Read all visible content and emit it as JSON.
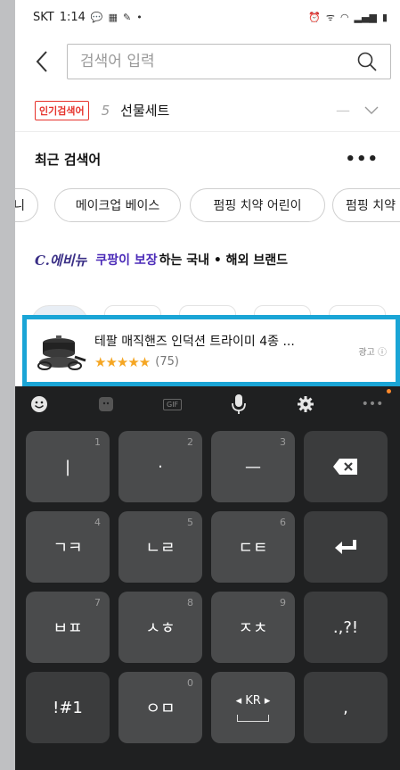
{
  "status_bar": {
    "carrier": "SKT",
    "time": "1:14"
  },
  "search": {
    "placeholder": "검색어 입력"
  },
  "popular": {
    "badge": "인기검색어",
    "rank": "5",
    "term": "선물세트"
  },
  "recent": {
    "title": "최근 검색어",
    "chips": [
      "니",
      "메이크업 베이스",
      "펌핑 치약 어린이",
      "펌핑 치약"
    ]
  },
  "brand": {
    "logo": "C.에비뉴",
    "highlight": "쿠팡이 보장",
    "rest": "하는 국내 • 해외 브랜드"
  },
  "ad": {
    "title": "테팔 매직핸즈 인덕션 트라이미 4종 ...",
    "rating_stars": 5,
    "review_count": "(75)",
    "badge": "광고"
  },
  "keyboard": {
    "rows": [
      [
        {
          "label": "|",
          "num": "1"
        },
        {
          "label": "·",
          "num": "2"
        },
        {
          "label": "—",
          "num": "3"
        },
        {
          "label": "",
          "icon": "backspace-icon"
        }
      ],
      [
        {
          "label": "ㄱㅋ",
          "num": "4"
        },
        {
          "label": "ㄴㄹ",
          "num": "5"
        },
        {
          "label": "ㄷㅌ",
          "num": "6"
        },
        {
          "label": "",
          "icon": "enter-icon"
        }
      ],
      [
        {
          "label": "ㅂㅍ",
          "num": "7"
        },
        {
          "label": "ㅅㅎ",
          "num": "8"
        },
        {
          "label": "ㅈㅊ",
          "num": "9"
        },
        {
          "label": ".,?!"
        }
      ],
      [
        {
          "label": "!#1"
        },
        {
          "label": "ㅇㅁ",
          "num": "0"
        },
        {
          "label": "◂ KR ▸"
        },
        {
          "label": ","
        }
      ]
    ]
  },
  "colors": {
    "accent_red": "#e6322b",
    "highlight_border": "#1aa5d6",
    "star": "#f5a623",
    "brand_purple": "#4b2bb8"
  }
}
